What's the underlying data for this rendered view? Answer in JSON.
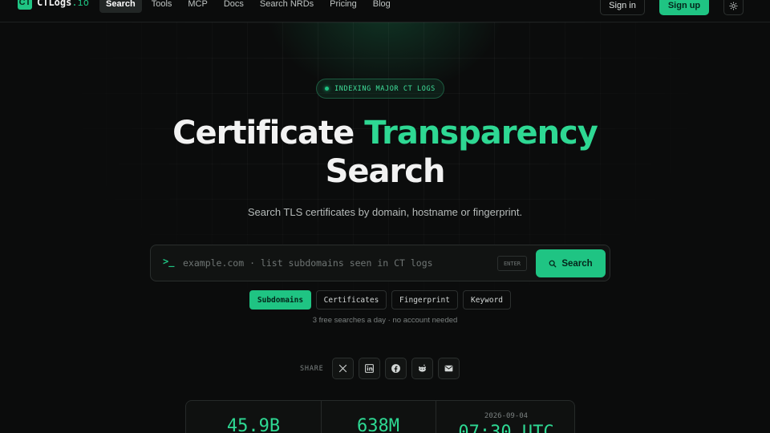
{
  "brand": {
    "logo_mark": "CT",
    "name": "CTLogs",
    "tld": ".io",
    "accent": "#1fc483"
  },
  "nav": {
    "links": [
      "Search",
      "Tools",
      "MCP",
      "Docs",
      "Search NRDs",
      "Pricing",
      "Blog"
    ],
    "active": "Search",
    "signin": "Sign in",
    "signup": "Sign up",
    "theme_icon": "sun-icon"
  },
  "hero": {
    "badge": "INDEXING MAJOR CT LOGS",
    "title_part1": "Certificate",
    "title_accent": "Transparency",
    "title_line2": "Search",
    "subtitle": "Search TLS certificates by domain, hostname or fingerprint."
  },
  "search": {
    "prompt_icon": "terminal-prompt-icon",
    "placeholder": "example.com · list subdomains seen in CT logs",
    "value": "",
    "enter_hint": "ENTER",
    "button_label": "Search"
  },
  "modes": {
    "items": [
      "Subdomains",
      "Certificates",
      "Fingerprint",
      "Keyword"
    ],
    "selected": "Subdomains",
    "note": "3 free searches a day · no account needed"
  },
  "share": {
    "label": "SHARE",
    "icons": [
      "x-icon",
      "linkedin-icon",
      "facebook-icon",
      "reddit-icon",
      "email-icon"
    ]
  },
  "stats": {
    "items": [
      "45.9B",
      "638M",
      "07:30 UTC"
    ],
    "date": "2026-09-04"
  }
}
